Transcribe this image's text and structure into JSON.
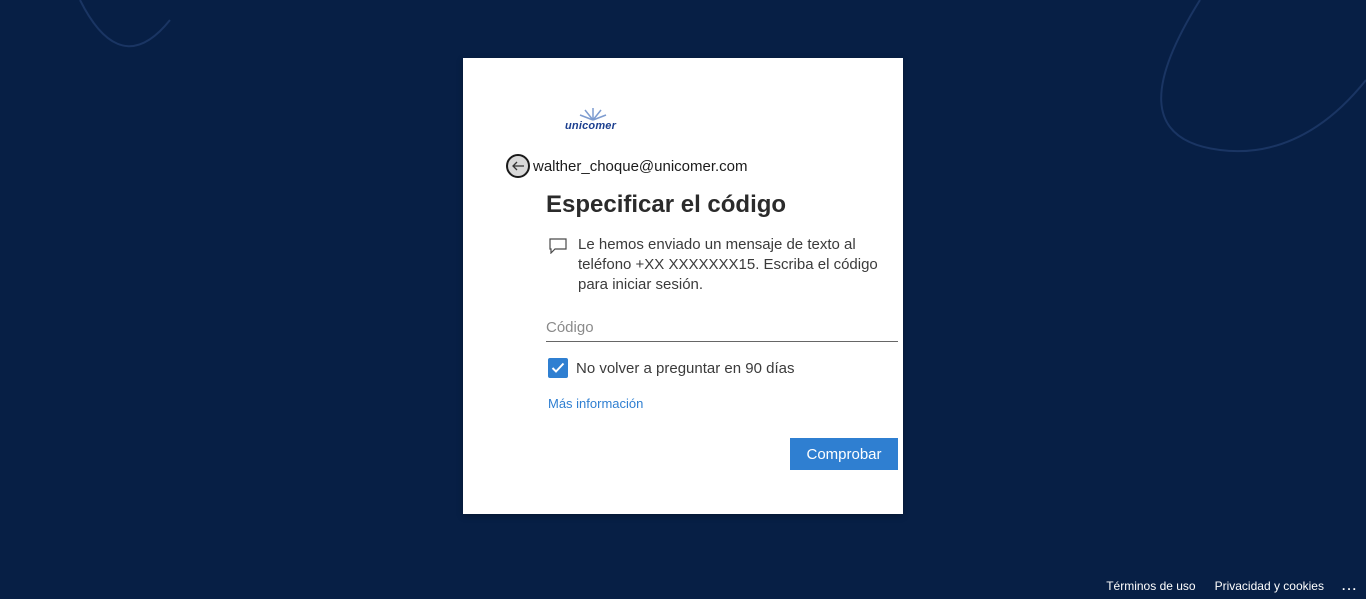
{
  "brand": {
    "logo_text": "unicomer",
    "primary_color": "#2f7fd1",
    "background_color": "#071f45"
  },
  "identity": {
    "email": "walther_choque@unicomer.com",
    "back_icon": "arrow-left-icon"
  },
  "form": {
    "title": "Especificar el código",
    "message_icon": "chat-bubble-icon",
    "message": "Le hemos enviado un mensaje de texto al teléfono +XX XXXXXXX15. Escriba el código para iniciar sesión.",
    "code_placeholder": "Código",
    "code_value": "",
    "remember_label": "No volver a preguntar en 90 días",
    "remember_checked": true,
    "more_info_label": "Más información",
    "submit_label": "Comprobar"
  },
  "footer": {
    "terms_label": "Términos de uso",
    "privacy_label": "Privacidad y cookies",
    "more_label": "..."
  }
}
